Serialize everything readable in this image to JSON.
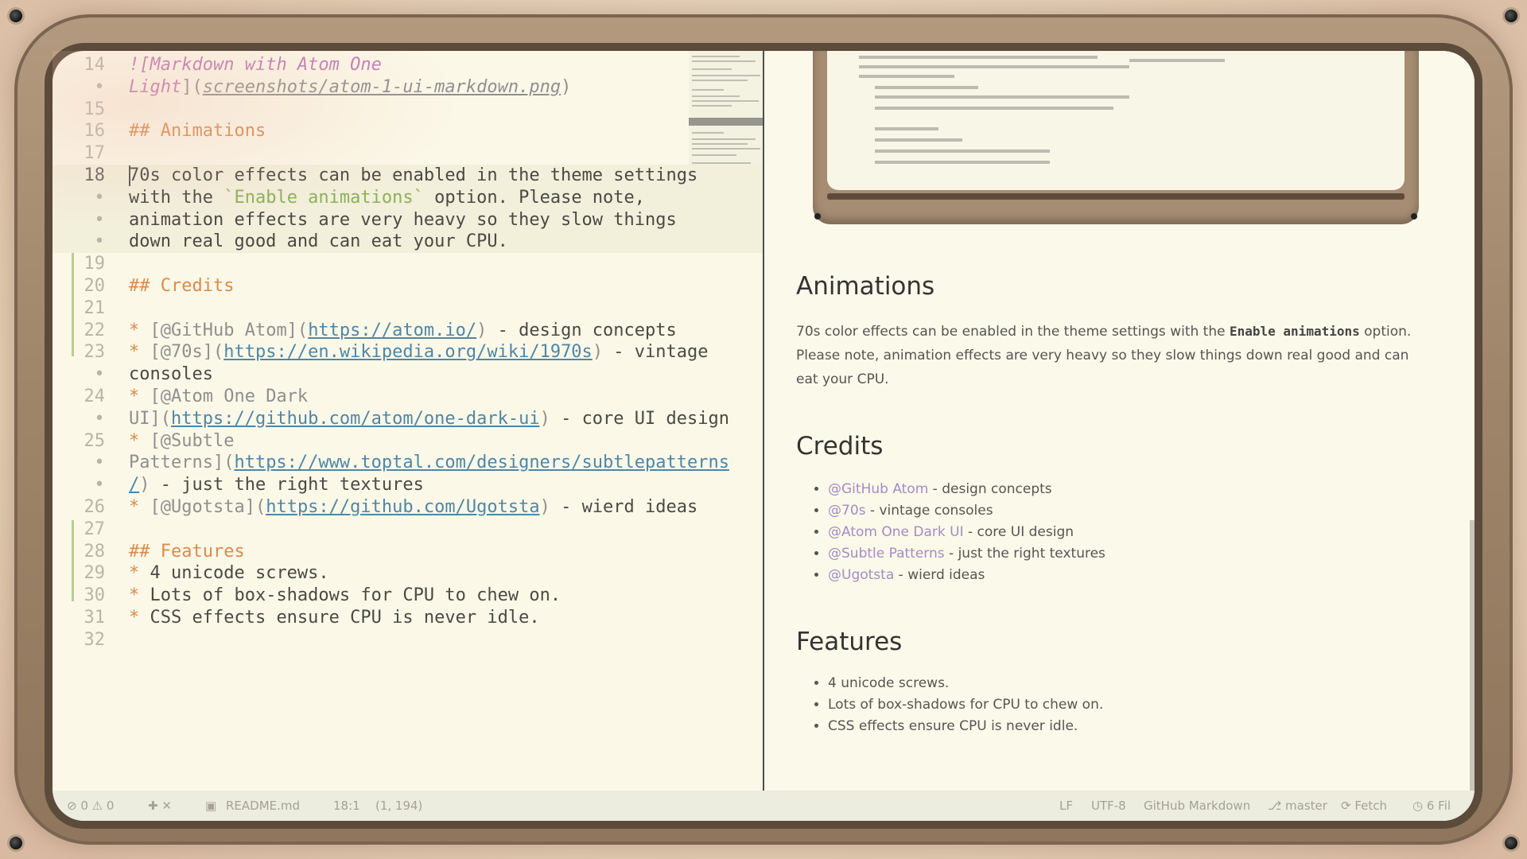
{
  "editor": {
    "lines": [
      {
        "num": "14",
        "parts": [
          {
            "t": "![",
            "c": "img-alt"
          },
          {
            "t": "Markdown with Atom One",
            "c": "img-alt"
          }
        ]
      },
      {
        "num": "•",
        "parts": [
          {
            "t": "Light",
            "c": "img-alt"
          },
          {
            "t": "](",
            "c": "lnk"
          },
          {
            "t": "screenshots/atom-1-ui-markdown.png",
            "c": "img-url"
          },
          {
            "t": ")",
            "c": "lnk"
          }
        ]
      },
      {
        "num": "15",
        "parts": []
      },
      {
        "num": "16",
        "parts": [
          {
            "t": "## Animations",
            "c": "hd"
          }
        ]
      },
      {
        "num": "17",
        "parts": []
      },
      {
        "num": "18",
        "cur": true,
        "parts": [
          {
            "t": "70s color effects can be enabled in the theme settings",
            "c": ""
          }
        ]
      },
      {
        "num": "•",
        "cur": true,
        "parts": [
          {
            "t": "with the ",
            "c": ""
          },
          {
            "t": "`Enable animations`",
            "c": "str"
          },
          {
            "t": " option. Please note,",
            "c": ""
          }
        ]
      },
      {
        "num": "•",
        "cur": true,
        "parts": [
          {
            "t": "animation effects are very heavy so they slow things",
            "c": ""
          }
        ]
      },
      {
        "num": "•",
        "cur": true,
        "parts": [
          {
            "t": "down real good and can eat your CPU.",
            "c": ""
          }
        ]
      },
      {
        "num": "19",
        "parts": []
      },
      {
        "num": "20",
        "parts": [
          {
            "t": "## Credits",
            "c": "hd"
          }
        ]
      },
      {
        "num": "21",
        "parts": []
      },
      {
        "num": "22",
        "parts": [
          {
            "t": "* ",
            "c": "star"
          },
          {
            "t": "[@GitHub Atom](",
            "c": "lnk"
          },
          {
            "t": "https://atom.io/",
            "c": "url"
          },
          {
            "t": ")",
            "c": "lnk"
          },
          {
            "t": " - design concepts",
            "c": ""
          }
        ]
      },
      {
        "num": "23",
        "parts": [
          {
            "t": "* ",
            "c": "star"
          },
          {
            "t": "[@70s](",
            "c": "lnk"
          },
          {
            "t": "https://en.wikipedia.org/wiki/1970s",
            "c": "url"
          },
          {
            "t": ")",
            "c": "lnk"
          },
          {
            "t": " - vintage",
            "c": ""
          }
        ]
      },
      {
        "num": "•",
        "parts": [
          {
            "t": "consoles",
            "c": ""
          }
        ]
      },
      {
        "num": "24",
        "parts": [
          {
            "t": "* ",
            "c": "star"
          },
          {
            "t": "[@Atom One Dark",
            "c": "lnk"
          }
        ]
      },
      {
        "num": "•",
        "parts": [
          {
            "t": "UI](",
            "c": "lnk"
          },
          {
            "t": "https://github.com/atom/one-dark-ui",
            "c": "url"
          },
          {
            "t": ")",
            "c": "lnk"
          },
          {
            "t": " - core UI design",
            "c": ""
          }
        ]
      },
      {
        "num": "25",
        "parts": [
          {
            "t": "* ",
            "c": "star"
          },
          {
            "t": "[@Subtle",
            "c": "lnk"
          }
        ]
      },
      {
        "num": "•",
        "parts": [
          {
            "t": "Patterns](",
            "c": "lnk"
          },
          {
            "t": "https://www.toptal.com/designers/subtlepatterns",
            "c": "url"
          }
        ]
      },
      {
        "num": "•",
        "parts": [
          {
            "t": "/",
            "c": "url"
          },
          {
            "t": ")",
            "c": "lnk"
          },
          {
            "t": " - just the right textures",
            "c": ""
          }
        ]
      },
      {
        "num": "26",
        "parts": [
          {
            "t": "* ",
            "c": "star"
          },
          {
            "t": "[@Ugotsta](",
            "c": "lnk"
          },
          {
            "t": "https://github.com/Ugotsta",
            "c": "url"
          },
          {
            "t": ")",
            "c": "lnk"
          },
          {
            "t": " - wierd ideas",
            "c": ""
          }
        ]
      },
      {
        "num": "27",
        "parts": []
      },
      {
        "num": "28",
        "parts": [
          {
            "t": "## Features",
            "c": "hd"
          }
        ]
      },
      {
        "num": "29",
        "parts": [
          {
            "t": "* ",
            "c": "star"
          },
          {
            "t": "4 unicode screws.",
            "c": ""
          }
        ]
      },
      {
        "num": "30",
        "parts": [
          {
            "t": "* ",
            "c": "star"
          },
          {
            "t": "Lots of box-shadows for CPU to chew on.",
            "c": ""
          }
        ]
      },
      {
        "num": "31",
        "parts": [
          {
            "t": "* ",
            "c": "star"
          },
          {
            "t": "CSS effects ensure CPU is never idle.",
            "c": ""
          }
        ]
      },
      {
        "num": "32",
        "parts": []
      }
    ]
  },
  "preview": {
    "animations": {
      "heading": "Animations",
      "text_before": "70s color effects can be enabled in the theme settings with the ",
      "code": "Enable animations",
      "text_after": " option. Please note, animation effects are very heavy so they slow things down real good and can eat your CPU."
    },
    "credits": {
      "heading": "Credits",
      "items": [
        {
          "link": "@GitHub Atom",
          "text": " - design concepts"
        },
        {
          "link": "@70s",
          "text": " - vintage consoles"
        },
        {
          "link": "@Atom One Dark UI",
          "text": " - core UI design"
        },
        {
          "link": "@Subtle Patterns",
          "text": " - just the right textures"
        },
        {
          "link": "@Ugotsta",
          "text": " - wierd ideas"
        }
      ]
    },
    "features": {
      "heading": "Features",
      "items": [
        "4 unicode screws.",
        "Lots of box-shadows for CPU to chew on.",
        "CSS effects ensure CPU is never idle."
      ]
    }
  },
  "status": {
    "diagnostics": "⊘ 0 ⚠ 0",
    "tools": "✚ ✕",
    "file_icon": "file-icon",
    "file": "README.md",
    "cursor_pos": "18:1",
    "selection": "(1, 194)",
    "line_ending": "LF",
    "encoding": "UTF-8",
    "grammar": "GitHub Markdown",
    "branch": "⎇ master",
    "fetch": "⟳ Fetch",
    "github": "◷ 6 Fil"
  },
  "colors": {
    "accent_orange": "#d98b4b",
    "link_blue": "#4f86a6",
    "preview_link": "#a48bc8",
    "bezel": "#9f8569"
  }
}
